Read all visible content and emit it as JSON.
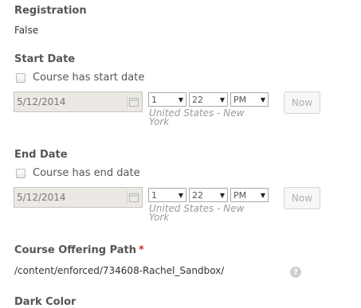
{
  "registration": {
    "label": "Registration",
    "value": "False"
  },
  "start_date": {
    "label": "Start Date",
    "checkbox_label": "Course has start date",
    "date_value": "5/12/2014",
    "hour": "1",
    "minute": "22",
    "ampm": "PM",
    "timezone_line1": "United States - New",
    "timezone_line2": "York",
    "now_label": "Now"
  },
  "end_date": {
    "label": "End Date",
    "checkbox_label": "Course has end date",
    "date_value": "5/12/2014",
    "hour": "1",
    "minute": "22",
    "ampm": "PM",
    "timezone_line1": "United States - New",
    "timezone_line2": "York",
    "now_label": "Now"
  },
  "course_offering_path": {
    "label": "Course Offering Path",
    "required_mark": "*",
    "value": "/content/enforced/734608-Rachel_Sandbox/",
    "help_icon": "question-icon"
  },
  "dark_color": {
    "label": "Dark Color"
  },
  "icons": {
    "dropdown_arrow": "▼",
    "help_glyph": "?"
  }
}
